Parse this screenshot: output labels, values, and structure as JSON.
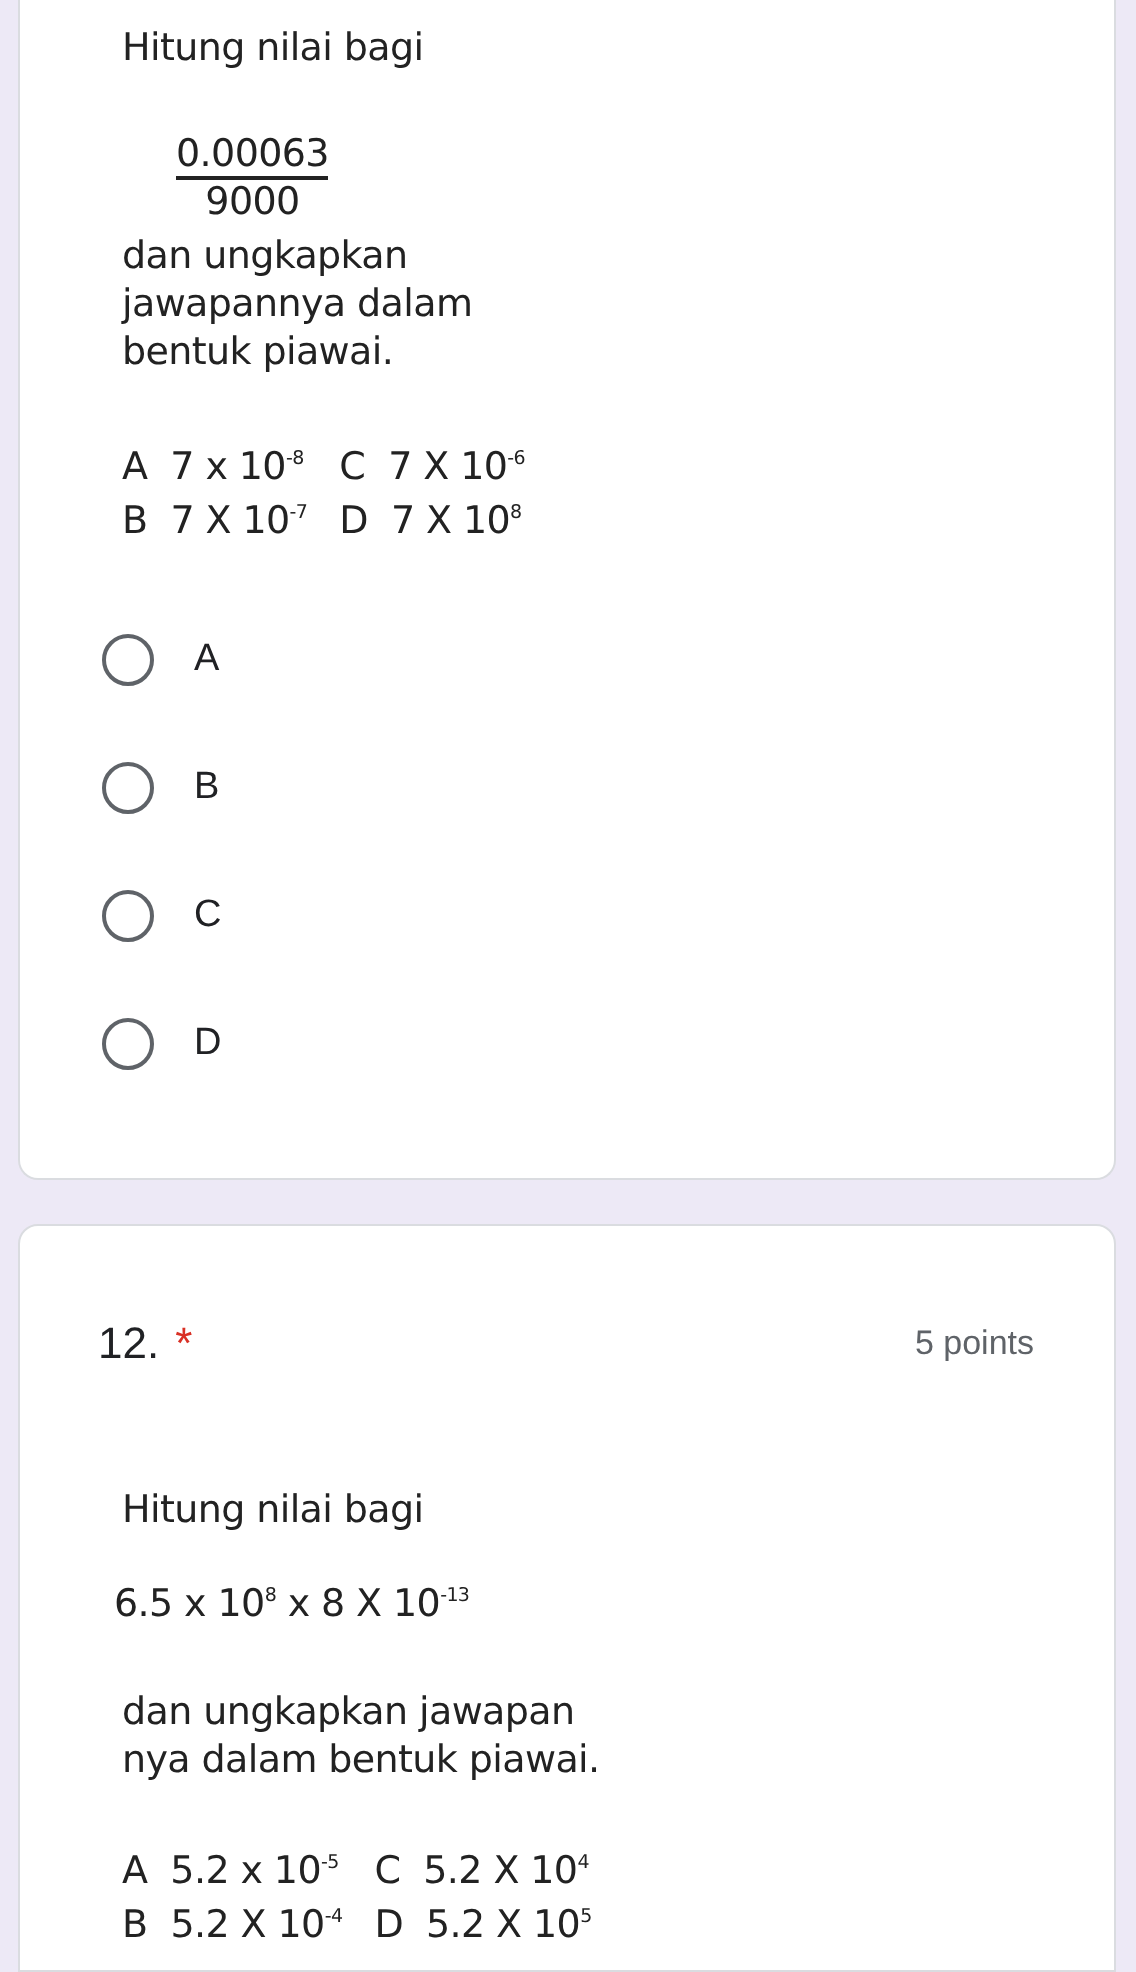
{
  "question_1": {
    "image_text": {
      "prompt": "Hitung nilai bagi",
      "numerator": "0.00063",
      "denominator": "9000",
      "instruction_lines": [
        "dan ungkapkan",
        "jawapannya dalam",
        "bentuk piawai."
      ],
      "choices": [
        {
          "letter": "A",
          "value": "7 x 10$^{-8}$"
        },
        {
          "letter": "C",
          "value": "7 X 10$^{-6}$"
        },
        {
          "letter": "B",
          "value": "7 X 10$^{-7}$"
        },
        {
          "letter": "D",
          "value": "7 X 10$^{8}$"
        }
      ]
    },
    "options": [
      {
        "label": "A",
        "selected": false
      },
      {
        "label": "B",
        "selected": false
      },
      {
        "label": "C",
        "selected": false
      },
      {
        "label": "D",
        "selected": false
      }
    ]
  },
  "question_2": {
    "number": "12.",
    "required_mark": "*",
    "points": "5 points",
    "image_text": {
      "prompt": "Hitung nilai bagi",
      "expression": "6.5 x 10$^{8}$ x 8 X 10$^{-13}$",
      "instruction_lines": [
        "dan ungkapkan jawapan",
        "nya dalam bentuk piawai."
      ],
      "choices": [
        {
          "letter": "A",
          "value": "5.2 x 10$^{-5}$"
        },
        {
          "letter": "C",
          "value": "5.2 X 10$^{4}$"
        },
        {
          "letter": "B",
          "value": "5.2 X 10$^{-4}$"
        },
        {
          "letter": "D",
          "value": "5.2 X 10$^{5}$"
        }
      ]
    }
  }
}
